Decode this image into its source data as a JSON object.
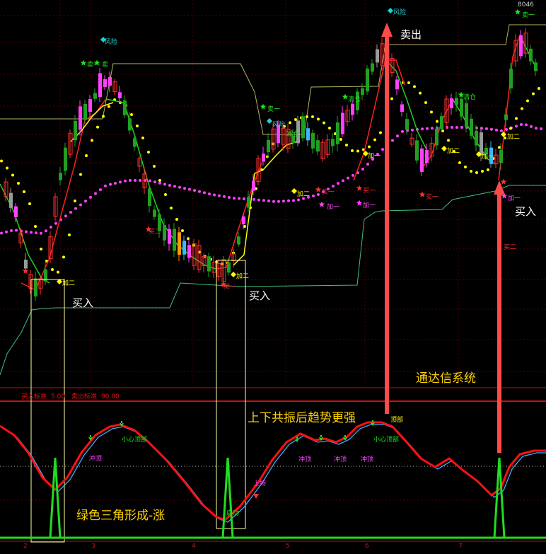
{
  "chart_data": [
    {
      "type": "candlestick",
      "title": "",
      "price_label": "8046",
      "series": [
        {
          "name": "",
          "color": "#ffff00",
          "style": "dotted"
        },
        {
          "name": "",
          "color": "#ff40ff",
          "style": "dotted"
        },
        {
          "name": "",
          "color": "#ff2020",
          "style": "line"
        },
        {
          "name": "",
          "color": "#20d020",
          "style": "line"
        },
        {
          "name": "",
          "color": "#b4b460",
          "style": "line"
        },
        {
          "name": "",
          "color": "#40c080",
          "style": "line"
        }
      ],
      "signals": [
        {
          "text": "风险",
          "color": "#20d0d0",
          "kind": "diamond"
        },
        {
          "text": "卖一",
          "color": "#20e020",
          "kind": "star"
        },
        {
          "text": "卖",
          "color": "#20e020",
          "kind": "star"
        },
        {
          "text": "卖一",
          "color": "#20e020",
          "kind": "star"
        },
        {
          "text": "风险",
          "color": "#20d0d0",
          "kind": "diamond"
        },
        {
          "text": "减仓",
          "color": "#20e020",
          "kind": "star"
        },
        {
          "text": "清仓",
          "color": "#20e020",
          "kind": "star"
        },
        {
          "text": "风险",
          "color": "#20d0d0",
          "kind": "diamond"
        },
        {
          "text": "清仓",
          "color": "#20e020",
          "kind": "star"
        },
        {
          "text": "卖一",
          "color": "#20e020",
          "kind": "star"
        },
        {
          "text": "加二",
          "color": "#ffff00",
          "kind": "diamond"
        },
        {
          "text": "加二",
          "color": "#ffff00",
          "kind": "diamond"
        },
        {
          "text": "加二",
          "color": "#ffff00",
          "kind": "diamond"
        },
        {
          "text": "加一",
          "color": "#ffff00",
          "kind": "diamond"
        },
        {
          "text": "加二",
          "color": "#ffff00",
          "kind": "diamond"
        },
        {
          "text": "加二",
          "color": "#ffff00",
          "kind": "diamond"
        },
        {
          "text": "加一",
          "color": "#ffff00",
          "kind": "diamond"
        },
        {
          "text": "买一",
          "color": "#ff3030",
          "kind": "star"
        },
        {
          "text": "加一",
          "color": "#ff40ff",
          "kind": "star"
        },
        {
          "text": "买一",
          "color": "#ff3030",
          "kind": "star"
        },
        {
          "text": "加一",
          "color": "#ff40ff",
          "kind": "star"
        },
        {
          "text": "买一",
          "color": "#ff3030",
          "kind": "star"
        },
        {
          "text": "加一",
          "color": "#ff40ff",
          "kind": "star"
        },
        {
          "text": "买二",
          "color": "#ff3030",
          "kind": "star"
        },
        {
          "text": "买二",
          "color": "#ff3030",
          "kind": "star"
        },
        {
          "text": "买一",
          "color": "#ff3030",
          "kind": "star"
        }
      ],
      "annotations": [
        "卖出",
        "买入",
        "买入",
        "买入"
      ]
    },
    {
      "type": "line",
      "header": [
        {
          "label": "买入标准",
          "value": "5.00"
        },
        {
          "label": "卖出标准",
          "value": "90.00"
        }
      ],
      "series": [
        {
          "name": "",
          "color": "#ff1010"
        },
        {
          "name": "",
          "color": "#4aa8ff"
        },
        {
          "name": "",
          "color": "#20dd20"
        }
      ],
      "labels": [
        "小心顶部",
        "冲顶",
        "上扬",
        "启动",
        "冲顶",
        "冲顶",
        "冲顶",
        "小心顶部",
        "顶部"
      ],
      "annotations": [
        "通达信系统",
        "上下共振后趋势更强",
        "绿色三角形成-涨"
      ],
      "x_ticks": [
        "2",
        "3",
        "4",
        "5",
        "6",
        "7"
      ]
    }
  ]
}
